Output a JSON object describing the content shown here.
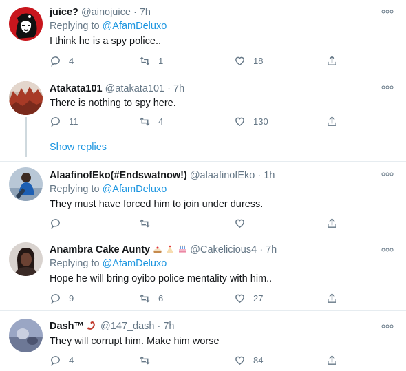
{
  "tweets": [
    {
      "name": "juice?",
      "handle": "@ainojuice",
      "dot": "·",
      "time": "7h",
      "replying_prefix": "Replying to ",
      "replying_to": "@AfamDeluxo",
      "text": "I think he is a spy police..",
      "replies": "4",
      "retweets": "1",
      "likes": "18",
      "avatar_icon": "che-portrait-avatar"
    },
    {
      "name": "Atakata101",
      "handle": "@atakata101",
      "dot": "·",
      "time": "7h",
      "text": "There is nothing to spy here.",
      "replies": "11",
      "retweets": "4",
      "likes": "130",
      "avatar_icon": "red-rock-landscape-avatar"
    },
    {
      "name": "AlaafinofEko(#Endswatnow!)",
      "handle": "@alaafinofEko",
      "dot": "·",
      "time": "1h",
      "replying_prefix": "Replying to ",
      "replying_to": "@AfamDeluxo",
      "text": "They must have forced him to join under duress.",
      "replies": "",
      "retweets": "",
      "likes": "",
      "avatar_icon": "person-blue-avatar"
    },
    {
      "name": "Anambra Cake Aunty",
      "handle": "@Cakelicious4",
      "dot": "·",
      "time": "7h",
      "replying_prefix": "Replying to ",
      "replying_to": "@AfamDeluxo",
      "text": "Hope he will bring oyibo police mentality with him..",
      "replies": "9",
      "retweets": "6",
      "likes": "27",
      "avatar_icon": "woman-portrait-avatar"
    },
    {
      "name": "Dash™",
      "handle": "@147_dash",
      "dot": "·",
      "time": "7h",
      "text": "They will corrupt him. Make him worse",
      "replies": "4",
      "retweets": "",
      "likes": "84",
      "avatar_icon": "blurry-photo-avatar"
    }
  ],
  "show_replies": "Show replies",
  "colors": {
    "link": "#1b95e0",
    "muted": "#657786",
    "text": "#14171a",
    "divider": "#e6ecf0"
  },
  "icons": [
    "reply-icon",
    "retweet-icon",
    "like-icon",
    "share-icon",
    "more-icon",
    "cake-emoji",
    "birthday-cake-emoji",
    "scorpion-emoji"
  ]
}
